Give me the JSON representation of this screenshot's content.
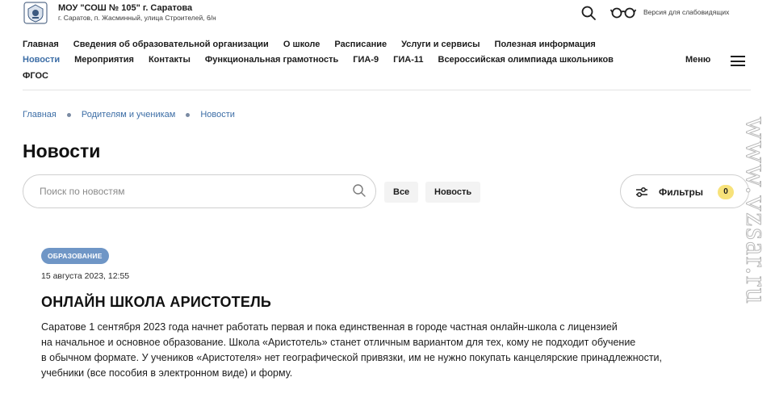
{
  "header": {
    "school_name": "МОУ \"СОШ № 105\" г. Саратова",
    "address": "г. Саратов, п. Жасминный, улица Строителей, 6/н",
    "vision_link": "Версия для слабовидящих",
    "logo_icon": "school-emblem-icon",
    "search_icon": "search-icon",
    "vision_icon": "glasses-icon"
  },
  "nav": {
    "row1": [
      "Главная",
      "Сведения об образовательной организации",
      "О школе",
      "Расписание",
      "Услуги и сервисы",
      "Полезная информация"
    ],
    "row2": [
      "Новости",
      "Мероприятия",
      "Контакты",
      "Функциональная грамотность",
      "ГИА-9",
      "ГИА-11",
      "Всероссийская олимпиада школьников"
    ],
    "row3": [
      "ФГОС"
    ],
    "active": "Новости",
    "menu_label": "Меню",
    "menu_icon": "burger-menu-icon"
  },
  "breadcrumb": [
    "Главная",
    "Родителям и ученикам",
    "Новости"
  ],
  "page_title": "Новости",
  "search": {
    "placeholder": "Поиск по новостям",
    "value": ""
  },
  "chips": {
    "all": "Все",
    "news": "Новость"
  },
  "filters": {
    "label": "Фильтры",
    "count": "0",
    "icon": "sliders-icon"
  },
  "article": {
    "tag": "ОБРАЗОВАНИЕ",
    "date": "15 августа 2023, 12:55",
    "title": "ОНЛАЙН ШКОЛА АРИСТОТЕЛЬ",
    "body_lines": [
      " Саратове 1 сентября 2023 года начнет работать первая и пока единственная в городе частная онлайн-школа с лицензией",
      "на начальное и основное образование. Школа «Аристотель» станет отличным вариантом для тех, кому не подходит обучение",
      "в обычном формате. У учеников «Аристотеля» нет географической привязки, им не нужно покупать канцелярские принадлежности,",
      "учебники (все пособия в электронном виде) и форму."
    ]
  },
  "watermark": "www.vzsar.ru",
  "colors": {
    "accent": "#3d6ea6",
    "tag_bg": "#6f96c6",
    "badge_bg": "#f7e27a"
  }
}
